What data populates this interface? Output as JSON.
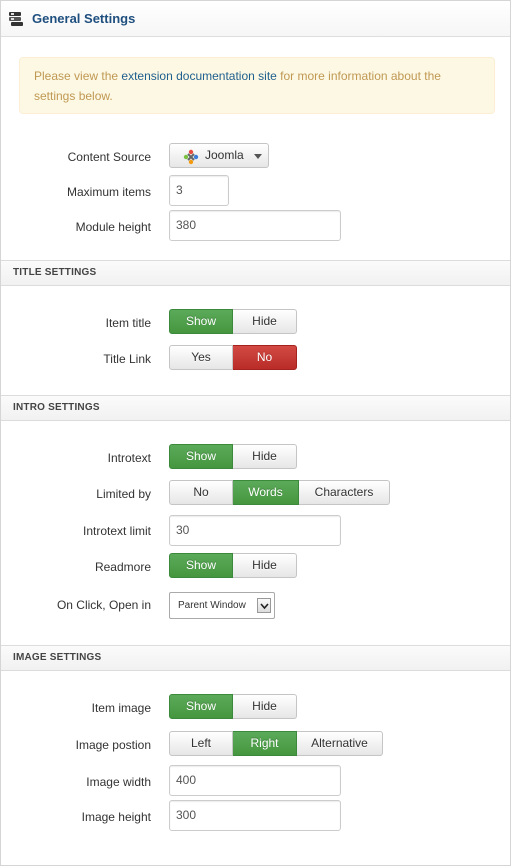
{
  "header": {
    "title": "General Settings",
    "icon": "stack-icon"
  },
  "alert": {
    "text_before": "Please view the ",
    "link_text": "extension documentation site",
    "text_after": " for more information about the settings below."
  },
  "general": {
    "content_source": {
      "label": "Content Source",
      "value": "Joomla"
    },
    "max_items": {
      "label": "Maximum items",
      "value": "3"
    },
    "module_height": {
      "label": "Module height",
      "value": "380"
    }
  },
  "title_settings": {
    "heading": "TITLE SETTINGS",
    "item_title": {
      "label": "Item title",
      "options": [
        "Show",
        "Hide"
      ],
      "selected": "Show"
    },
    "title_link": {
      "label": "Title Link",
      "options": [
        "Yes",
        "No"
      ],
      "selected": "No"
    }
  },
  "intro_settings": {
    "heading": "INTRO SETTINGS",
    "introtext": {
      "label": "Introtext",
      "options": [
        "Show",
        "Hide"
      ],
      "selected": "Show"
    },
    "limited_by": {
      "label": "Limited by",
      "options": [
        "No",
        "Words",
        "Characters"
      ],
      "selected": "Words"
    },
    "introtext_limit": {
      "label": "Introtext limit",
      "value": "30"
    },
    "readmore": {
      "label": "Readmore",
      "options": [
        "Show",
        "Hide"
      ],
      "selected": "Show"
    },
    "on_click": {
      "label": "On Click, Open in",
      "value": "Parent Window"
    }
  },
  "image_settings": {
    "heading": "IMAGE SETTINGS",
    "item_image": {
      "label": "Item image",
      "options": [
        "Show",
        "Hide"
      ],
      "selected": "Show"
    },
    "image_position": {
      "label": "Image postion",
      "options": [
        "Left",
        "Right",
        "Alternative"
      ],
      "selected": "Right"
    },
    "image_width": {
      "label": "Image width",
      "value": "400"
    },
    "image_height": {
      "label": "Image height",
      "value": "300"
    }
  },
  "colors": {
    "active_green": "#46963f",
    "active_red": "#b92c28",
    "alert_text": "#c09853",
    "link": "#1f5f8f"
  }
}
